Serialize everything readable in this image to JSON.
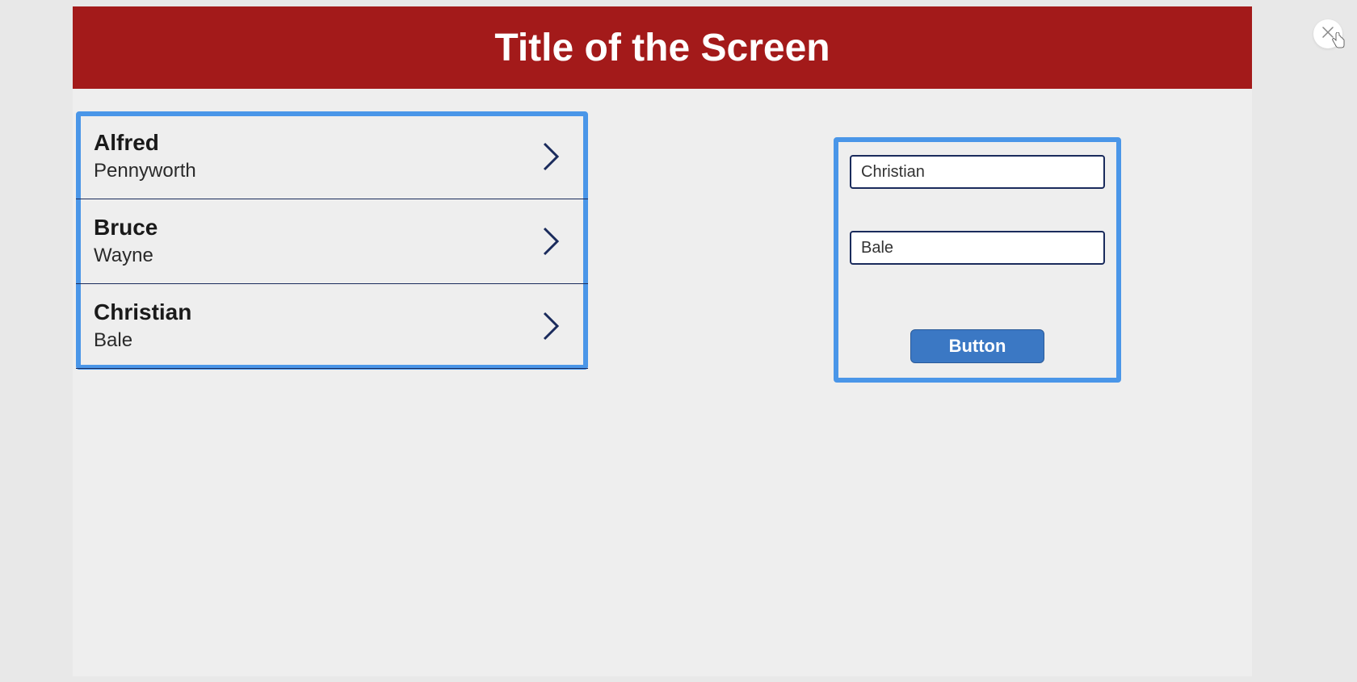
{
  "header": {
    "title": "Title of the Screen"
  },
  "list": {
    "items": [
      {
        "primary": "Alfred",
        "secondary": "Pennyworth"
      },
      {
        "primary": "Bruce",
        "secondary": "Wayne"
      },
      {
        "primary": "Christian",
        "secondary": "Bale"
      }
    ]
  },
  "form": {
    "input1_value": "Christian",
    "input2_value": "Bale",
    "button_label": "Button"
  },
  "colors": {
    "header_bg": "#a31a1a",
    "highlight_border": "#4a96e8",
    "button_bg": "#3b78c4",
    "input_border": "#1a2b5c"
  }
}
